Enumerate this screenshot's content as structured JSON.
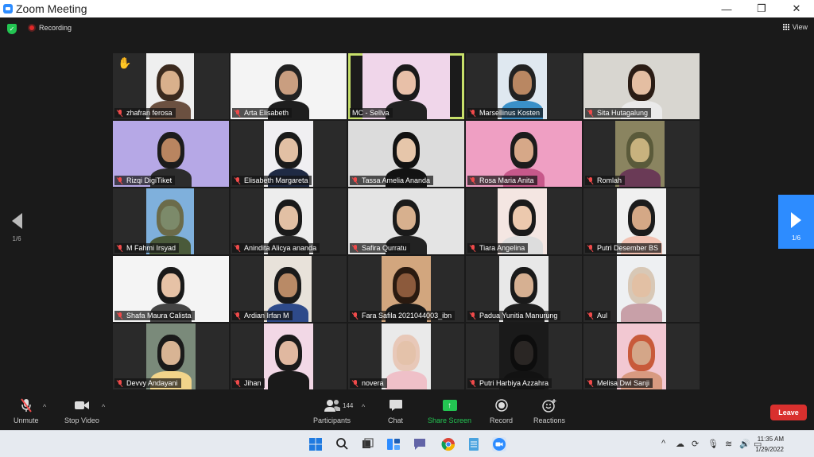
{
  "window": {
    "title": "Zoom Meeting",
    "minimize": "—",
    "maximize": "❐",
    "close": "✕"
  },
  "topbar": {
    "recording_label": "Recording",
    "view_label": "View"
  },
  "navigation": {
    "page_left": "1/6",
    "page_right": "1/6"
  },
  "participants": [
    {
      "name": "zhafran ferosa",
      "muted": true,
      "hand_raised": true,
      "bg": "#2a2a2a",
      "frame": "#efefef",
      "hair": "#3b2a1e",
      "skin": "#d9b08c",
      "shirt": "#6b5040",
      "vx": 42,
      "vw": 60
    },
    {
      "name": "Arta Elisabeth",
      "muted": true,
      "bg": "#f4f4f4",
      "frame": "#f4f4f4",
      "hair": "#222",
      "skin": "#c99e80",
      "shirt": "#1e1e1e",
      "vx": 0,
      "vw": 146
    },
    {
      "name": "MC - Sellva",
      "muted": false,
      "active": true,
      "bg": "#1b1b1b",
      "frame": "#f0d6ea",
      "hair": "#1a1a1a",
      "skin": "#e8c0a8",
      "shirt": "#222",
      "vx": 18,
      "vw": 110
    },
    {
      "name": "Marsellinus Kosten",
      "muted": true,
      "bg": "#2a2a2a",
      "frame": "#dfe8f0",
      "hair": "#222",
      "skin": "#b98762",
      "shirt": "#3a90c8",
      "vx": 40,
      "vw": 62
    },
    {
      "name": "Sita Hutagalung",
      "muted": true,
      "bg": "#d8d6d0",
      "frame": "#d8d6d0",
      "hair": "#2a1c14",
      "skin": "#e4bea2",
      "shirt": "#eaeaea",
      "vx": 0,
      "vw": 146
    },
    {
      "name": "Rizqi DigiTiket",
      "muted": true,
      "bg": "#f3f3f3",
      "frame": "#b6a8e6",
      "hair": "#1c1c1c",
      "skin": "#b98560",
      "shirt": "#2c2c2c",
      "vx": 0,
      "vw": 146
    },
    {
      "name": "Elisabeth Margareta",
      "muted": true,
      "bg": "#2a2a2a",
      "frame": "#f0eff2",
      "hair": "#1a1a1a",
      "skin": "#e2c0a4",
      "shirt": "#1f2a44",
      "vx": 42,
      "vw": 62
    },
    {
      "name": "Tassa Amelia Ananda",
      "muted": true,
      "bg": "#dcdcdc",
      "frame": "#dcdcdc",
      "hair": "#121212",
      "skin": "#e6c6aa",
      "shirt": "#121212",
      "vx": 0,
      "vw": 146
    },
    {
      "name": "Rosa Maria Anita",
      "muted": true,
      "bg": "#ef9fc3",
      "frame": "#ef9fc3",
      "hair": "#1c1c1c",
      "skin": "#d6a888",
      "shirt": "#c7588a",
      "vx": 0,
      "vw": 146
    },
    {
      "name": "Romlah",
      "muted": true,
      "bg": "#2a2a2a",
      "frame": "#8a8460",
      "hair": "#5a5a3a",
      "skin": "#c8b27e",
      "shirt": "#6a3a56",
      "vx": 40,
      "vw": 62
    },
    {
      "name": "M Fahmi Irsyad",
      "muted": true,
      "bg": "#2a2a2a",
      "frame": "#7fb0dc",
      "hair": "#6b6b4a",
      "skin": "#7c8a6a",
      "shirt": "#4a5a3a",
      "vx": 42,
      "vw": 60
    },
    {
      "name": "Anindita Alicya ananda",
      "muted": true,
      "bg": "#2a2a2a",
      "frame": "#ededed",
      "hair": "#1a1a1a",
      "skin": "#e2c0a4",
      "shirt": "#2a2a2a",
      "vx": 42,
      "vw": 62
    },
    {
      "name": "Safira Qurratu",
      "muted": true,
      "bg": "#e4e4e4",
      "frame": "#e4e4e4",
      "hair": "#1a1a1a",
      "skin": "#d7b08e",
      "shirt": "#222",
      "vx": 0,
      "vw": 146
    },
    {
      "name": "Tiara Angelina",
      "muted": true,
      "bg": "#2a2a2a",
      "frame": "#f4e6e2",
      "hair": "#1a1a1a",
      "skin": "#ecc9ae",
      "shirt": "#ddd",
      "vx": 40,
      "vw": 62
    },
    {
      "name": "Putri Desember BS",
      "muted": true,
      "bg": "#2a2a2a",
      "frame": "#f0f0f0",
      "hair": "#1c1c1c",
      "skin": "#d4a886",
      "shirt": "#f2c2b2",
      "vx": 42,
      "vw": 62
    },
    {
      "name": "Shafa Maura Calista",
      "muted": true,
      "bg": "#f4f4f4",
      "frame": "#f4f4f4",
      "hair": "#1a1a1a",
      "skin": "#e6c2a6",
      "shirt": "#444",
      "vx": 0,
      "vw": 146
    },
    {
      "name": "Ardian Irfan M",
      "muted": true,
      "bg": "#2a2a2a",
      "frame": "#e8e2da",
      "hair": "#1a1a1a",
      "skin": "#b98a66",
      "shirt": "#2e4a8a",
      "vx": 42,
      "vw": 60
    },
    {
      "name": "Fara Safila 2021044003_ibn",
      "muted": true,
      "bg": "#2a2a2a",
      "frame": "#d2a67e",
      "hair": "#2a1a10",
      "skin": "#8c5a3c",
      "shirt": "#1a1a1a",
      "vx": 42,
      "vw": 62
    },
    {
      "name": "Padua Yunitia Manurung",
      "muted": true,
      "bg": "#2a2a2a",
      "frame": "#e8e8e8",
      "hair": "#1a1a1a",
      "skin": "#d6b092",
      "shirt": "#1e1e1e",
      "vx": 42,
      "vw": 62
    },
    {
      "name": "Aul",
      "muted": true,
      "bg": "#2a2a2a",
      "frame": "#eef0f2",
      "hair": "#d8c8b6",
      "skin": "#e2c0a4",
      "shirt": "#c8a0a8",
      "vx": 42,
      "vw": 62
    },
    {
      "name": "Devvy Andayani",
      "muted": true,
      "bg": "#2a2a2a",
      "frame": "#7a8a7a",
      "hair": "#1a1a1a",
      "skin": "#d8b494",
      "shirt": "#f2d48a",
      "vx": 42,
      "vw": 62
    },
    {
      "name": "Jihan",
      "muted": true,
      "bg": "#2a2a2a",
      "frame": "#f2d8e6",
      "hair": "#1a1a1a",
      "skin": "#e0b8a0",
      "shirt": "#1a1a1a",
      "vx": 42,
      "vw": 62
    },
    {
      "name": "novera",
      "muted": true,
      "bg": "#2a2a2a",
      "frame": "#eaeaea",
      "hair": "#e8c8b8",
      "skin": "#e4c2aa",
      "shirt": "#efc0c8",
      "vx": 42,
      "vw": 62
    },
    {
      "name": "Putri Harbiya Azzahra",
      "muted": true,
      "bg": "#2a2a2a",
      "frame": "#1a1a1a",
      "hair": "#0d0d0d",
      "skin": "#2a2624",
      "shirt": "#121212",
      "vx": 42,
      "vw": 62
    },
    {
      "name": "Melisa Dwi Sanji",
      "muted": true,
      "bg": "#2a2a2a",
      "frame": "#f2c8d2",
      "hair": "#c85a3a",
      "skin": "#d4a688",
      "shirt": "#d89a80",
      "vx": 42,
      "vw": 62
    }
  ],
  "toolbar": {
    "unmute": "Unmute",
    "stop_video": "Stop Video",
    "participants": "Participants",
    "participants_count": "144",
    "chat": "Chat",
    "share_screen": "Share Screen",
    "record": "Record",
    "reactions": "Reactions",
    "leave": "Leave"
  },
  "taskbar": {
    "time": "11:35 AM",
    "date": "1/29/2022",
    "tray_chevron": "^"
  }
}
